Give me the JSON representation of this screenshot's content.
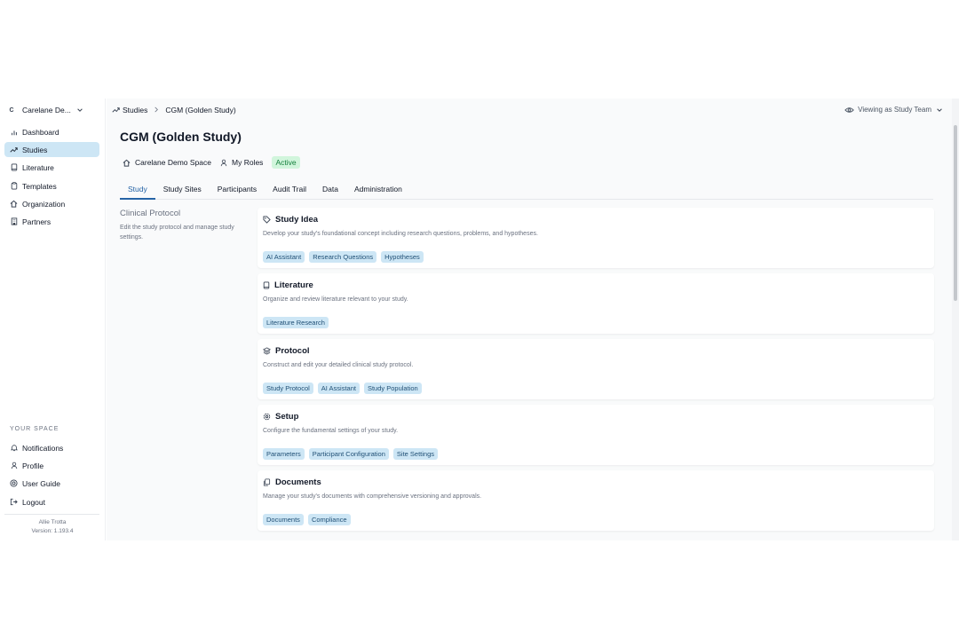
{
  "sidebar": {
    "workspace_initial": "C",
    "workspace_name": "Carelane De...",
    "nav": [
      {
        "label": "Dashboard",
        "icon": "bar-chart-icon"
      },
      {
        "label": "Studies",
        "icon": "trending-up-icon",
        "active": true
      },
      {
        "label": "Literature",
        "icon": "book-icon"
      },
      {
        "label": "Templates",
        "icon": "clipboard-icon"
      },
      {
        "label": "Organization",
        "icon": "home-icon"
      },
      {
        "label": "Partners",
        "icon": "building-icon"
      }
    ],
    "section_label": "YOUR SPACE",
    "space_nav": [
      {
        "label": "Notifications",
        "icon": "bell-icon"
      },
      {
        "label": "Profile",
        "icon": "user-icon"
      },
      {
        "label": "User Guide",
        "icon": "life-buoy-icon"
      },
      {
        "label": "Logout",
        "icon": "logout-icon"
      }
    ],
    "user_name": "Allie Trotta",
    "version": "Version: 1.193.4"
  },
  "header": {
    "breadcrumb": [
      "Studies",
      "CGM (Golden Study)"
    ],
    "viewing_as": "Viewing as Study Team"
  },
  "study": {
    "title": "CGM (Golden Study)",
    "space": "Carelane Demo Space",
    "roles": "My Roles",
    "status": "Active"
  },
  "tabs": [
    "Study",
    "Study Sites",
    "Participants",
    "Audit Trail",
    "Data",
    "Administration"
  ],
  "section": {
    "title": "Clinical Protocol",
    "description": "Edit the study protocol and manage study settings."
  },
  "cards": [
    {
      "title": "Study Idea",
      "icon": "tag-icon",
      "description": "Develop your study's foundational concept including research questions, problems, and hypotheses.",
      "chips": [
        "AI Assistant",
        "Research Questions",
        "Hypotheses"
      ]
    },
    {
      "title": "Literature",
      "icon": "book-icon",
      "description": "Organize and review literature relevant to your study.",
      "chips": [
        "Literature Research"
      ]
    },
    {
      "title": "Protocol",
      "icon": "layers-icon",
      "description": "Construct and edit your detailed clinical study protocol.",
      "chips": [
        "Study Protocol",
        "AI Assistant",
        "Study Population"
      ]
    },
    {
      "title": "Setup",
      "icon": "gear-icon",
      "description": "Configure the fundamental settings of your study.",
      "chips": [
        "Parameters",
        "Participant Configuration",
        "Site Settings"
      ]
    },
    {
      "title": "Documents",
      "icon": "documents-icon",
      "description": "Manage your study's documents with comprehensive versioning and approvals.",
      "chips": [
        "Documents",
        "Compliance"
      ]
    }
  ]
}
